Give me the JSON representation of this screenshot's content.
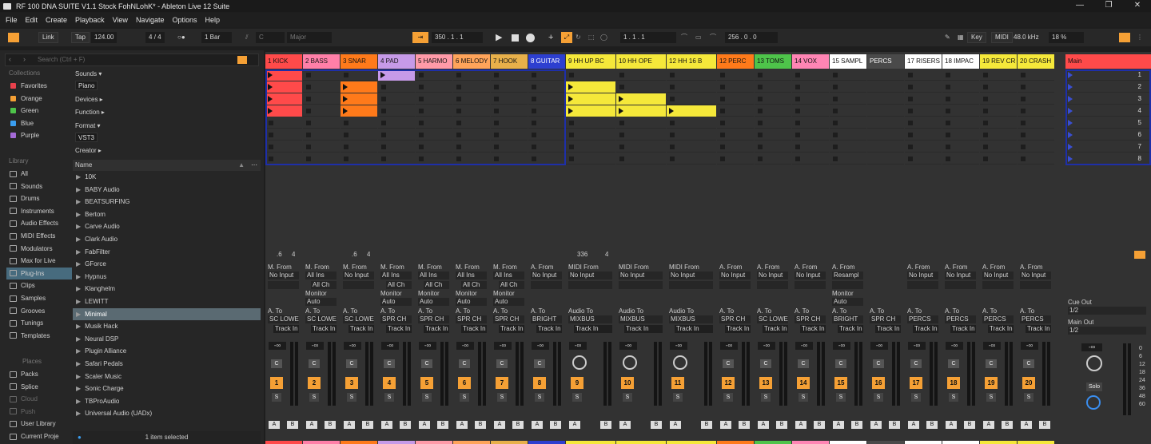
{
  "window": {
    "title": "RF 100 DNA SUITE V1.1 Stock FohNLohK* - Ableton Live 12 Suite"
  },
  "menu": [
    "File",
    "Edit",
    "Create",
    "Playback",
    "View",
    "Navigate",
    "Options",
    "Help"
  ],
  "control": {
    "link": "Link",
    "tap": "Tap",
    "tempo": "124.00",
    "sig_num": "4",
    "sig_sep": "/",
    "sig_den": "4",
    "metro": "○●",
    "quant": "1 Bar",
    "key": "C",
    "scale": "Major",
    "position": "350 .  1 .  1",
    "loop_start": "1 .  1 .  1",
    "loop_len": "256 .  0 .  0",
    "key_label": "Key",
    "midi_label": "MIDI",
    "sample_rate": "48.0 kHz",
    "cpu": "18 %"
  },
  "browser": {
    "search_placeholder": "Search (Ctrl + F)",
    "collections_title": "Collections",
    "collections": [
      {
        "label": "Favorites",
        "color": "#e8414c"
      },
      {
        "label": "Orange",
        "color": "#f5a035"
      },
      {
        "label": "Green",
        "color": "#4ec44a"
      },
      {
        "label": "Blue",
        "color": "#3a9ef0"
      },
      {
        "label": "Purple",
        "color": "#a46ad7"
      }
    ],
    "library_title": "Library",
    "library": [
      "All",
      "Sounds",
      "Drums",
      "Instruments",
      "Audio Effects",
      "MIDI Effects",
      "Modulators",
      "Max for Live",
      "Plug-Ins",
      "Clips",
      "Samples",
      "Grooves",
      "Tunings",
      "Templates"
    ],
    "library_selected": 8,
    "places_title": "Places",
    "places": [
      "Packs",
      "Splice",
      "Cloud",
      "Push",
      "User Library",
      "Current Proje"
    ],
    "filters": {
      "sounds": "Sounds ▾",
      "sounds_tag": "Piano",
      "devices": "Devices ▸",
      "function": "Function ▸",
      "format": "Format ▾",
      "format_tag": "VST3",
      "creator": "Creator ▸"
    },
    "name_header": "Name",
    "folders": [
      "10K",
      "BABY Audio",
      "BEATSURFING",
      "Bertom",
      "Carve Audio",
      "Clark Audio",
      "FabFilter",
      "GForce",
      "Hypnus",
      "Klanghelm",
      "LEWITT",
      "Minimal",
      "Musik Hack",
      "Neural DSP",
      "Plugin Alliance",
      "Safari Pedals",
      "Scaler Music",
      "Sonic Charge",
      "TBProAudio",
      "Universal Audio (UADx)"
    ],
    "folder_selected": 11,
    "status": "1 item selected"
  },
  "tracks": [
    {
      "name": "1 KICK",
      "color": "#ff4a4a",
      "num": "1",
      "clips": [
        0,
        1,
        2,
        3
      ],
      "in1": "M. From",
      "in2": "No Input",
      "in3": "",
      "mon1": "",
      "mon2": "",
      "out1": "A. To",
      "out2": "SC LOWE",
      "out3": "Track In",
      "vol": "-∞",
      "kind": "audio",
      "extra": ".6",
      "extra2": "4"
    },
    {
      "name": "2 BASS",
      "color": "#ff7fa8",
      "num": "2",
      "clips": [],
      "in1": "M. From",
      "in2": "All Ins",
      "in3": "All Ch",
      "mon1": "Monitor",
      "mon2": "Auto",
      "out1": "A. To",
      "out2": "SC LOWE",
      "out3": "Track In",
      "vol": "-∞",
      "kind": "audio"
    },
    {
      "name": "3 SNAR",
      "color": "#ff7a1a",
      "num": "3",
      "clips": [
        1,
        2,
        3
      ],
      "in1": "M. From",
      "in2": "No Input",
      "in3": "",
      "mon1": "",
      "mon2": "",
      "out1": "A. To",
      "out2": "SC LOWE",
      "out3": "Track In",
      "vol": "-∞",
      "kind": "audio",
      "extra": ".6",
      "extra2": "4"
    },
    {
      "name": "4 PAD",
      "color": "#c69ae8",
      "num": "4",
      "clips": [
        0
      ],
      "in1": "M. From",
      "in2": "All Ins",
      "in3": "All Ch",
      "mon1": "Monitor",
      "mon2": "Auto",
      "out1": "A. To",
      "out2": "SPR CH",
      "out3": "Track In",
      "vol": "-∞",
      "kind": "audio"
    },
    {
      "name": "5 HARMO",
      "color": "#ff9aa8",
      "num": "5",
      "clips": [],
      "in1": "M. From",
      "in2": "All Ins",
      "in3": "All Ch",
      "mon1": "Monitor",
      "mon2": "Auto",
      "out1": "A. To",
      "out2": "SPR CH",
      "out3": "Track In",
      "vol": "-∞",
      "kind": "audio"
    },
    {
      "name": "6 MELODY",
      "color": "#ffa45a",
      "num": "6",
      "clips": [],
      "in1": "M. From",
      "in2": "All Ins",
      "in3": "All Ch",
      "mon1": "Monitor",
      "mon2": "Auto",
      "out1": "A. To",
      "out2": "SPR CH",
      "out3": "Track In",
      "vol": "-∞",
      "kind": "audio"
    },
    {
      "name": "7 HOOK",
      "color": "#e8b04a",
      "num": "7",
      "clips": [],
      "in1": "M. From",
      "in2": "All Ins",
      "in3": "All Ch",
      "mon1": "Monitor",
      "mon2": "Auto",
      "out1": "A. To",
      "out2": "SPR CH",
      "out3": "Track In",
      "vol": "-∞",
      "kind": "audio"
    },
    {
      "name": "8 GUITAR",
      "color": "#2d3fd0",
      "num": "8",
      "clips": [],
      "in1": "A. From",
      "in2": "No Input",
      "in3": "",
      "mon1": "",
      "mon2": "",
      "out1": "A. To",
      "out2": "BRIGHT",
      "out3": "Track In",
      "vol": "-∞",
      "kind": "audio"
    },
    {
      "name": "9 HH UP BC",
      "color": "#f5e83a",
      "num": "9",
      "clips": [
        1,
        2,
        3
      ],
      "in1": "MIDI From",
      "in2": "No Input",
      "in3": "",
      "mon1": "",
      "mon2": "",
      "out1": "Audio To",
      "out2": "MIXBUS",
      "out3": "Track In",
      "vol": "-∞",
      "kind": "midi",
      "extra": "336",
      "extra2": "4"
    },
    {
      "name": "10 HH OPE",
      "color": "#f5e83a",
      "num": "10",
      "clips": [
        2,
        3
      ],
      "in1": "MIDI From",
      "in2": "No Input",
      "in3": "",
      "mon1": "",
      "mon2": "",
      "out1": "Audio To",
      "out2": "MIXBUS",
      "out3": "Track In",
      "vol": "-∞",
      "kind": "midi"
    },
    {
      "name": "12 HH 16 B",
      "color": "#f5e83a",
      "num": "11",
      "clips": [
        3
      ],
      "in1": "MIDI From",
      "in2": "No Input",
      "in3": "",
      "mon1": "",
      "mon2": "",
      "out1": "Audio To",
      "out2": "MIXBUS",
      "out3": "Track In",
      "vol": "-∞",
      "kind": "midi"
    },
    {
      "name": "12 PERC",
      "color": "#ff7a1a",
      "num": "12",
      "clips": [],
      "in1": "A. From",
      "in2": "No Input",
      "in3": "",
      "mon1": "",
      "mon2": "",
      "out1": "A. To",
      "out2": "SPR CH",
      "out3": "Track In",
      "vol": "-∞",
      "kind": "audio"
    },
    {
      "name": "13 TOMS",
      "color": "#4ec44a",
      "num": "13",
      "clips": [],
      "in1": "A. From",
      "in2": "No Input",
      "in3": "",
      "mon1": "",
      "mon2": "",
      "out1": "A. To",
      "out2": "SC LOWE",
      "out3": "Track In",
      "vol": "-∞",
      "kind": "audio"
    },
    {
      "name": "14 VOX",
      "color": "#ff85b4",
      "num": "14",
      "clips": [],
      "in1": "A. From",
      "in2": "No Input",
      "in3": "",
      "mon1": "",
      "mon2": "",
      "out1": "A. To",
      "out2": "SPR CH",
      "out3": "Track In",
      "vol": "-∞",
      "kind": "audio"
    },
    {
      "name": "15 SAMPL",
      "color": "#ffffff",
      "num": "15",
      "clips": [],
      "in1": "A. From",
      "in2": "Resampl",
      "in3": "",
      "mon1": "Monitor",
      "mon2": "Auto",
      "out1": "A. To",
      "out2": "BRIGHT",
      "out3": "Track In",
      "vol": "-∞",
      "kind": "audio"
    },
    {
      "name": "PERCS",
      "color": "#4a4a4a",
      "num": "16",
      "clips": [],
      "in1": "",
      "in2": "",
      "in3": "",
      "mon1": "",
      "mon2": "",
      "out1": "A. To",
      "out2": "SPR CH",
      "out3": "Track In",
      "vol": "-∞",
      "kind": "group"
    },
    {
      "name": "17 RISERS",
      "color": "#ffffff",
      "num": "17",
      "clips": [],
      "in1": "A. From",
      "in2": "No Input",
      "in3": "",
      "mon1": "",
      "mon2": "",
      "out1": "A. To",
      "out2": "PERCS",
      "out3": "Track In",
      "vol": "-∞",
      "kind": "audio"
    },
    {
      "name": "18 IMPAC",
      "color": "#ffffff",
      "num": "18",
      "clips": [],
      "in1": "A. From",
      "in2": "No Input",
      "in3": "",
      "mon1": "",
      "mon2": "",
      "out1": "A. To",
      "out2": "PERCS",
      "out3": "Track In",
      "vol": "-∞",
      "kind": "audio"
    },
    {
      "name": "19 REV CR",
      "color": "#f5e83a",
      "num": "19",
      "clips": [],
      "in1": "A. From",
      "in2": "No Input",
      "in3": "",
      "mon1": "",
      "mon2": "",
      "out1": "A. To",
      "out2": "PERCS",
      "out3": "Track In",
      "vol": "-∞",
      "kind": "audio"
    },
    {
      "name": "20 CRASH",
      "color": "#f5e83a",
      "num": "20",
      "clips": [],
      "in1": "A. From",
      "in2": "No Input",
      "in3": "",
      "mon1": "",
      "mon2": "",
      "out1": "A. To",
      "out2": "PERCS",
      "out3": "Track In",
      "vol": "-∞",
      "kind": "audio"
    }
  ],
  "main": {
    "name": "Main",
    "color": "#ff4a4a",
    "scenes": [
      "1",
      "2",
      "3",
      "4",
      "5",
      "6",
      "7",
      "8"
    ],
    "cue_out": "Cue Out",
    "cue_val": "1/2",
    "main_out": "Main Out",
    "main_val": "1/2",
    "vol": "-∞",
    "solo": "Solo",
    "db": [
      "0",
      "6",
      "12",
      "18",
      "24",
      "36",
      "48",
      "60"
    ]
  },
  "colors": {
    "accent": "#f5a035",
    "selection_frame": "#1e2fa8",
    "clip_yellow": "#f5e83a",
    "clip_red": "#ff4a4a",
    "clip_orange": "#ff7a1a"
  }
}
